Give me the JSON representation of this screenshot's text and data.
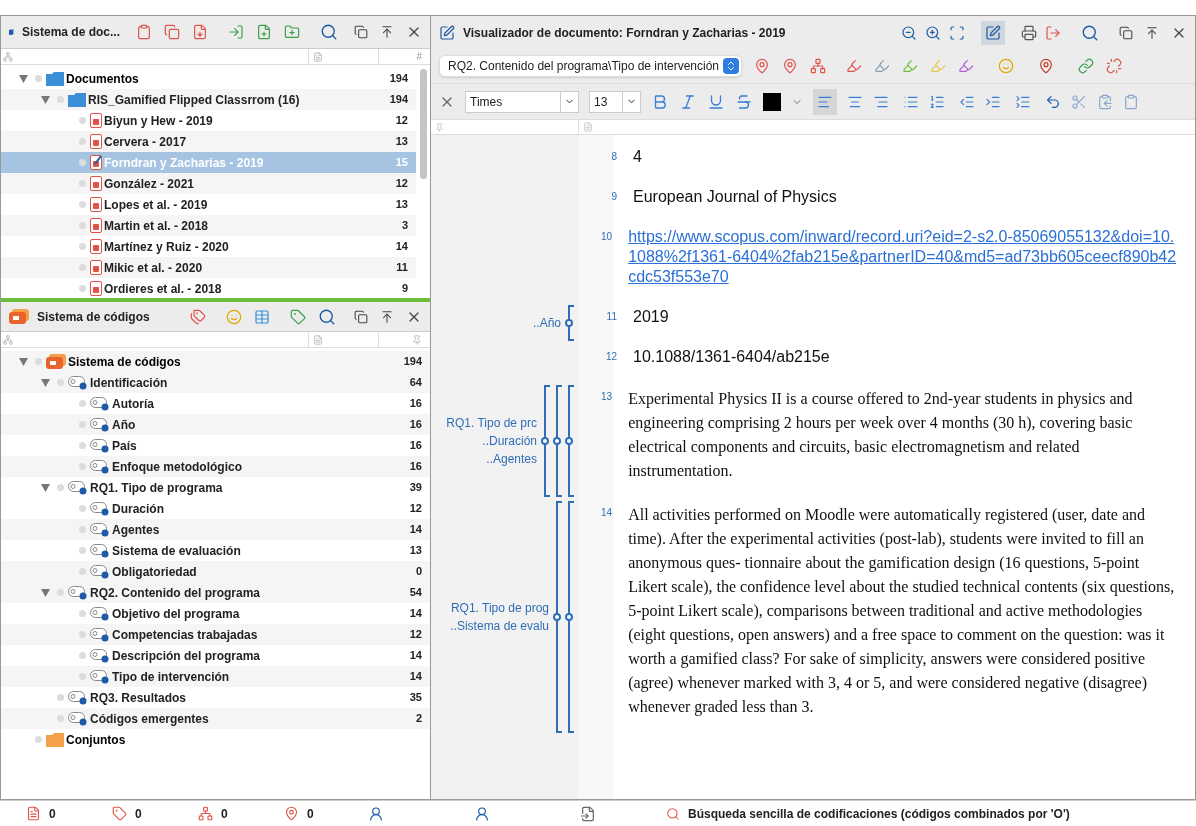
{
  "document_system": {
    "title": "Sistema de doc...",
    "count_header": "#",
    "tree": [
      {
        "kind": "folder",
        "label": "Documentos",
        "count": "194",
        "bold": true,
        "expanded": true,
        "selected": false,
        "children": [
          {
            "kind": "folder",
            "label": "RIS_Gamified Flipped Classrrom (16)",
            "count": "194",
            "bold": false,
            "expanded": true,
            "selected": false,
            "children": [
              {
                "kind": "document",
                "label": "Biyun y Hew - 2019",
                "count": "12",
                "selected": false
              },
              {
                "kind": "document",
                "label": "Cervera - 2017",
                "count": "13",
                "selected": false
              },
              {
                "kind": "open_document",
                "label": "Forndran y Zacharias - 2019",
                "count": "15",
                "selected": true
              },
              {
                "kind": "document",
                "label": "González - 2021",
                "count": "12",
                "selected": false
              },
              {
                "kind": "document",
                "label": "Lopes et al. - 2019",
                "count": "13",
                "selected": false
              },
              {
                "kind": "document",
                "label": "Martin et al. - 2018",
                "count": "3",
                "selected": false
              },
              {
                "kind": "document",
                "label": "Martínez y Ruiz - 2020",
                "count": "14",
                "selected": false
              },
              {
                "kind": "document",
                "label": "Mikic et al. - 2020",
                "count": "11",
                "selected": false
              },
              {
                "kind": "document",
                "label": "Ordieres et al. - 2018",
                "count": "9",
                "selected": false
              }
            ]
          }
        ]
      }
    ]
  },
  "code_system": {
    "title": "Sistema de códigos",
    "tree": [
      {
        "kind": "root",
        "label": "Sistema de códigos",
        "count": "194",
        "bold": true,
        "expanded": true,
        "children": [
          {
            "kind": "code",
            "label": "Identificación",
            "count": "64",
            "expanded": true,
            "children": [
              {
                "kind": "code",
                "label": "Autoría",
                "count": "16"
              },
              {
                "kind": "code",
                "label": "Año",
                "count": "16"
              },
              {
                "kind": "code",
                "label": "País",
                "count": "16"
              },
              {
                "kind": "code",
                "label": "Enfoque metodológico",
                "count": "16"
              }
            ]
          },
          {
            "kind": "code",
            "label": "RQ1. Tipo de programa",
            "count": "39",
            "expanded": true,
            "children": [
              {
                "kind": "code",
                "label": "Duración",
                "count": "12"
              },
              {
                "kind": "code",
                "label": "Agentes",
                "count": "14"
              },
              {
                "kind": "code",
                "label": "Sistema de evaluación",
                "count": "13"
              },
              {
                "kind": "code",
                "label": "Obligatoriedad",
                "count": "0"
              }
            ]
          },
          {
            "kind": "code",
            "label": "RQ2. Contenido del programa",
            "count": "54",
            "expanded": true,
            "children": [
              {
                "kind": "code",
                "label": "Objetivo del programa",
                "count": "14"
              },
              {
                "kind": "code",
                "label": "Competencias trabajadas",
                "count": "12"
              },
              {
                "kind": "code",
                "label": "Descripción del programa",
                "count": "14"
              },
              {
                "kind": "code",
                "label": "Tipo de intervención",
                "count": "14"
              }
            ]
          },
          {
            "kind": "code",
            "label": "RQ3. Resultados",
            "count": "35"
          },
          {
            "kind": "code",
            "label": "Códigos emergentes",
            "count": "2"
          }
        ]
      },
      {
        "kind": "set_folder",
        "label": "Conjuntos",
        "bold": true
      }
    ]
  },
  "viewer": {
    "title": "Visualizador de documento: Forndran y Zacharias - 2019",
    "code_selector": "RQ2. Contenido del programa\\Tipo de intervención",
    "font": "Times",
    "font_size": "13",
    "paragraphs": [
      {
        "number": "8",
        "kind": "sans",
        "text": "4"
      },
      {
        "number": "9",
        "kind": "sans",
        "text": "European Journal of Physics"
      },
      {
        "number": "10",
        "kind": "link",
        "text": "https://www.scopus.com/inward/record.uri?eid=2-s2.0-85069055132&doi=10.1088%2f1361-6404%2fab215e&partnerID=40&md5=ad73bb605ceecf890b42cdc53f553e70"
      },
      {
        "number": "11",
        "kind": "sans",
        "text": "2019",
        "codings": [
          "..Año"
        ]
      },
      {
        "number": "12",
        "kind": "sans",
        "text": "10.1088/1361-6404/ab215e"
      },
      {
        "number": "13",
        "kind": "serif",
        "text": "Experimental Physics II is a course offered to 2nd-year students in physics and engineering comprising 2 hours per week over 4 months (30 h), covering basic electrical components and circuits, basic electromagnetism and related instrumentation.",
        "codings": [
          "RQ1. Tipo de prc",
          "..Duración",
          "..Agentes"
        ]
      },
      {
        "number": "14",
        "kind": "serif",
        "text": "All activities performed on Moodle were automatically registered (user, date and time). After the experimental activities (post-lab), students were invited to fill an anonymous ques- tionnaire about the gamification design (16 questions, 5-point Likert scale), the confidence level about the studied technical contents (six questions, 5-point Likert scale), comparisons between traditional and active methodologies (eight questions, open answers) and a free space to comment on the question: was it worth a gamified class? For sake of simplicity, answers were considered positive (agree) whenever marked with 3, 4 or 5, and were considered negative (disagree) whenever graded less than 3.",
        "codings": [
          "RQ1. Tipo de prog",
          "..Sistema de evalu"
        ]
      }
    ]
  },
  "status_bar": {
    "counters": [
      {
        "kind": "documents",
        "count": "0"
      },
      {
        "kind": "codes",
        "count": "0"
      },
      {
        "kind": "code_links",
        "count": "0"
      },
      {
        "kind": "weights",
        "count": "0"
      }
    ],
    "search_mode": "Búsqueda sencilla de codificaciones (códigos combinados por 'O')"
  }
}
